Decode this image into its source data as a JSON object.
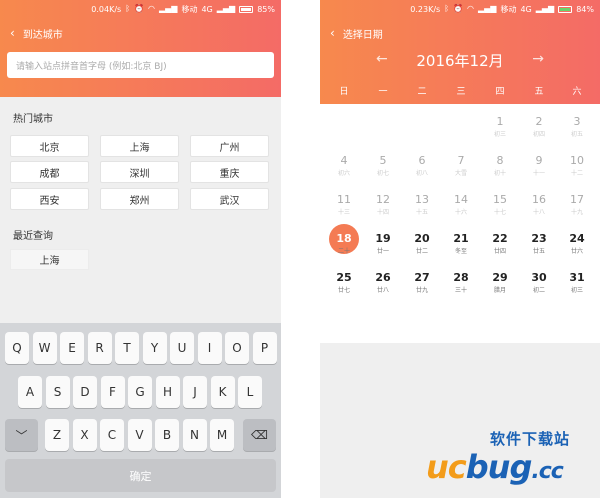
{
  "left_screen": {
    "status": {
      "speed": "0.04K/s",
      "carrier": "移动",
      "network": "4G",
      "battery": "85%",
      "battery_fraction": 0.85
    },
    "nav_title": "到达城市",
    "search_placeholder": "请输入站点拼音首字母 (例如:北京 BJ)",
    "hot_title": "热门城市",
    "hot_cities": [
      "北京",
      "上海",
      "广州",
      "成都",
      "深圳",
      "重庆",
      "西安",
      "郑州",
      "武汉"
    ],
    "recent_title": "最近查询",
    "recent_cities": [
      "上海"
    ],
    "keyboard": {
      "row1": [
        "Q",
        "W",
        "E",
        "R",
        "T",
        "Y",
        "U",
        "I",
        "O",
        "P"
      ],
      "row2": [
        "A",
        "S",
        "D",
        "F",
        "G",
        "H",
        "J",
        "K",
        "L"
      ],
      "row3": [
        "Z",
        "X",
        "C",
        "V",
        "B",
        "N",
        "M"
      ],
      "hide_key": "﹀",
      "delete_key": "⌫",
      "confirm": "确定"
    }
  },
  "right_screen": {
    "status": {
      "speed": "0.23K/s",
      "carrier": "移动",
      "network": "4G",
      "battery": "84%",
      "battery_fraction": 0.84
    },
    "nav_title": "选择日期",
    "month_title": "2016年12月",
    "prev_arrow": "←",
    "next_arrow": "→",
    "weekdays": [
      "日",
      "一",
      "二",
      "三",
      "四",
      "五",
      "六"
    ],
    "rows": [
      [
        null,
        null,
        null,
        null,
        {
          "d": "1",
          "l": "初三"
        },
        {
          "d": "2",
          "l": "初四"
        },
        {
          "d": "3",
          "l": "初五"
        }
      ],
      [
        {
          "d": "4",
          "l": "初六"
        },
        {
          "d": "5",
          "l": "初七"
        },
        {
          "d": "6",
          "l": "初八"
        },
        {
          "d": "7",
          "l": "大雪"
        },
        {
          "d": "8",
          "l": "初十"
        },
        {
          "d": "9",
          "l": "十一"
        },
        {
          "d": "10",
          "l": "十二"
        }
      ],
      [
        {
          "d": "11",
          "l": "十三"
        },
        {
          "d": "12",
          "l": "十四"
        },
        {
          "d": "13",
          "l": "十五"
        },
        {
          "d": "14",
          "l": "十六"
        },
        {
          "d": "15",
          "l": "十七"
        },
        {
          "d": "16",
          "l": "十八"
        },
        {
          "d": "17",
          "l": "十九"
        }
      ],
      [
        {
          "d": "18",
          "l": "二十"
        },
        {
          "d": "19",
          "l": "廿一"
        },
        {
          "d": "20",
          "l": "廿二"
        },
        {
          "d": "21",
          "l": "冬至"
        },
        {
          "d": "22",
          "l": "廿四"
        },
        {
          "d": "23",
          "l": "廿五"
        },
        {
          "d": "24",
          "l": "廿六"
        }
      ],
      [
        {
          "d": "25",
          "l": "廿七"
        },
        {
          "d": "26",
          "l": "廿八"
        },
        {
          "d": "27",
          "l": "廿九"
        },
        {
          "d": "28",
          "l": "三十"
        },
        {
          "d": "29",
          "l": "腊月"
        },
        {
          "d": "30",
          "l": "初二"
        },
        {
          "d": "31",
          "l": "初三"
        }
      ]
    ],
    "today": "18"
  },
  "watermark": {
    "cn": "软件下载站",
    "uc": "uc",
    "bug": "bug",
    "cc": ".cc"
  },
  "colors": {
    "gradient_start": "#f7894d",
    "gradient_end": "#f46b66",
    "today": "#f47b54"
  }
}
